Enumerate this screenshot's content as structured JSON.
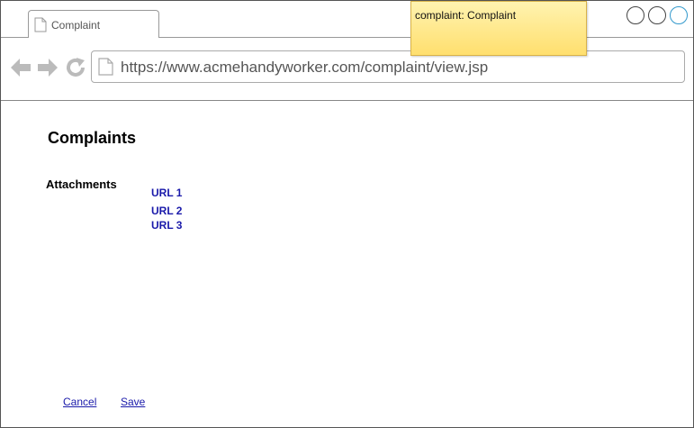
{
  "browser": {
    "tab_title": "Complaint",
    "url": "https://www.acmehandyworker.com/complaint/view.jsp"
  },
  "note": {
    "text": "complaint: Complaint"
  },
  "page": {
    "title": "Complaints",
    "attachments_label": "Attachments",
    "attachments": [
      "URL 1",
      "URL 2",
      "URL 3"
    ],
    "cancel_label": "Cancel",
    "save_label": "Save"
  },
  "colors": {
    "link": "#1a1aaa",
    "note_bg": "#ffdf6e",
    "active_window_button": "#3399cc"
  },
  "icons": [
    "document-icon",
    "back-arrow-icon",
    "forward-arrow-icon",
    "reload-icon"
  ]
}
